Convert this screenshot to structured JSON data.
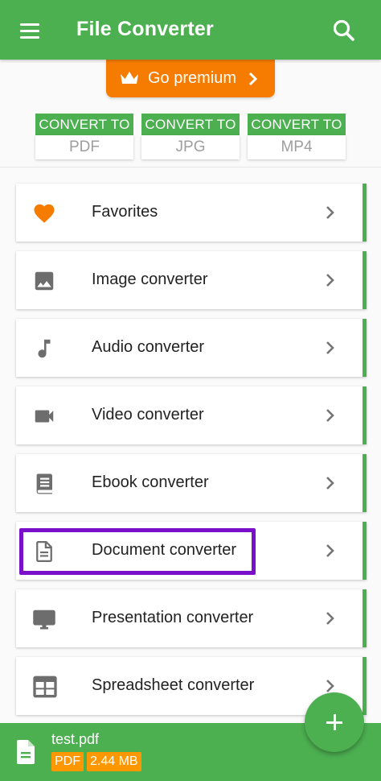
{
  "app": {
    "title": "File Converter",
    "primary_color": "#4caf50",
    "accent_color": "#f57c00",
    "highlight_color": "#7a10c9"
  },
  "premium": {
    "label": "Go premium",
    "icon": "crown-icon"
  },
  "quick_convert": [
    {
      "header": "CONVERT TO",
      "format": "PDF"
    },
    {
      "header": "CONVERT TO",
      "format": "JPG"
    },
    {
      "header": "CONVERT TO",
      "format": "MP4"
    }
  ],
  "menu": [
    {
      "label": "Favorites",
      "icon": "heart-icon"
    },
    {
      "label": "Image converter",
      "icon": "image-icon"
    },
    {
      "label": "Audio converter",
      "icon": "music-note-icon"
    },
    {
      "label": "Video converter",
      "icon": "videocam-icon"
    },
    {
      "label": "Ebook converter",
      "icon": "book-icon"
    },
    {
      "label": "Document converter",
      "icon": "document-icon"
    },
    {
      "label": "Presentation converter",
      "icon": "monitor-icon"
    },
    {
      "label": "Spreadsheet converter",
      "icon": "table-icon"
    }
  ],
  "current_file": {
    "name": "test.pdf",
    "type": "PDF",
    "size": "2.44 MB"
  }
}
